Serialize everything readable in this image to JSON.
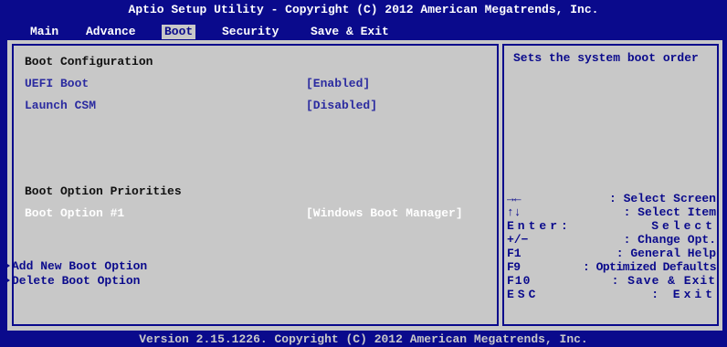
{
  "window": {
    "title": "Aptio Setup Utility - Copyright (C) 2012 American Megatrends, Inc.",
    "footer": "Version 2.15.1226. Copyright (C) 2012 American Megatrends, Inc."
  },
  "menu": {
    "tabs": [
      {
        "label": "Main"
      },
      {
        "label": "Advance"
      },
      {
        "label": "Boot"
      },
      {
        "label": "Security"
      },
      {
        "label": "Save & Exit"
      }
    ],
    "active": "Boot"
  },
  "boot": {
    "section_title": "Boot Configuration",
    "uefi_label": "UEFI Boot",
    "uefi_value": "[Enabled]",
    "csm_label": "Launch CSM",
    "csm_value": "[Disabled]",
    "priorities_title": "Boot Option Priorities",
    "option1_label": "Boot Option #1",
    "option1_value": "[Windows Boot Manager]",
    "add_label": "Add New Boot Option",
    "delete_label": "Delete Boot Option"
  },
  "help": {
    "text": "Sets the system boot order"
  },
  "keys": [
    {
      "key": "→←",
      "desc": ": Select Screen"
    },
    {
      "key": "↑↓",
      "desc": ": Select Item"
    },
    {
      "key": "Enter:",
      "desc": "Select"
    },
    {
      "key": "+/−",
      "desc": ": Change Opt."
    },
    {
      "key": "F1",
      "desc": ": General Help"
    },
    {
      "key": "F9",
      "desc": ": Optimized Defaults"
    },
    {
      "key": "F10",
      "desc": ": Save & Exit"
    },
    {
      "key": "ESC",
      "desc": ": Exit"
    }
  ],
  "colors": {
    "frame": "#0a0a8c",
    "panel": "#c8c8c8",
    "link_text": "#2b2ba0",
    "selected_text": "#ffffff"
  }
}
